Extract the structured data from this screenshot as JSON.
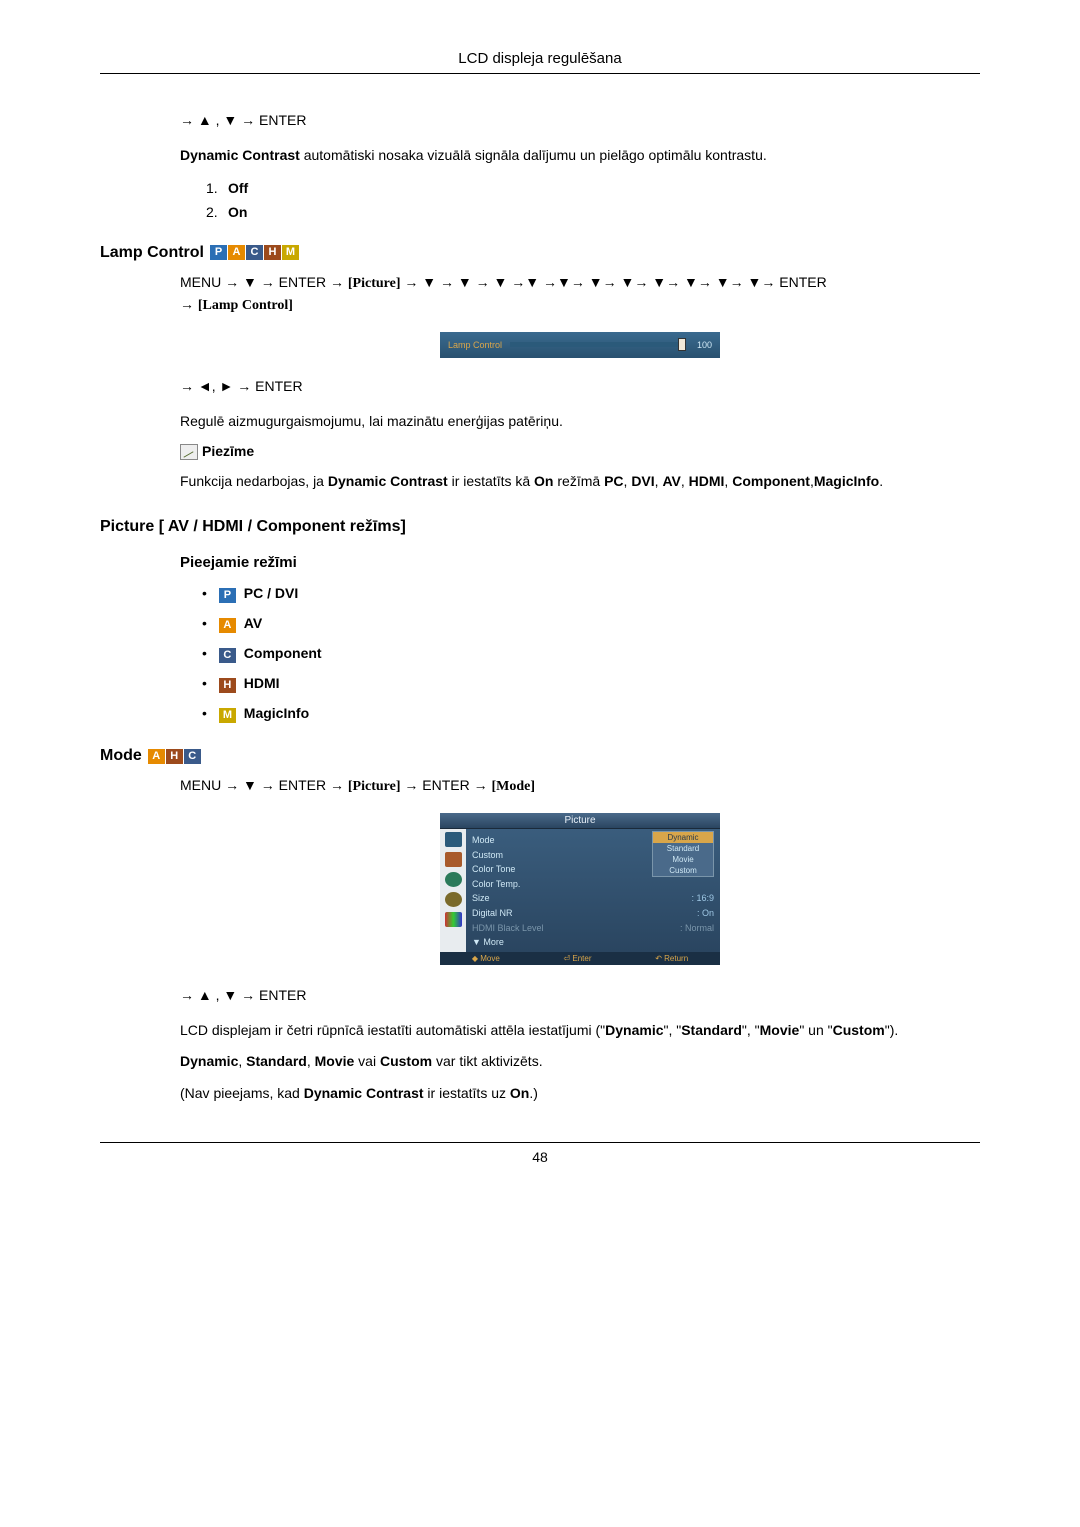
{
  "header": {
    "title": "LCD displeja regulēšana"
  },
  "dynamic_contrast": {
    "nav": "→ ▲ , ▼ → ENTER",
    "desc_prefix_bold": "Dynamic Contrast",
    "desc_rest": " automātiski nosaka vizuālā signāla dalījumu un pielāgo optimālu kontrastu.",
    "options": [
      "Off",
      "On"
    ]
  },
  "lamp_control": {
    "title": "Lamp Control",
    "badges": [
      "P",
      "A",
      "C",
      "H",
      "M"
    ],
    "nav_line1_pre": "MENU → ▼ → ENTER → ",
    "nav_line1_pic": "[Picture]",
    "nav_line1_post": " → ▼ → ▼ → ▼ →▼ →▼→ ▼→ ▼→ ▼→ ▼→ ▼→ ▼→ ENTER",
    "nav_line2": "→ ",
    "nav_line2_lc": "[Lamp Control]",
    "bar_label": "Lamp Control",
    "bar_value": "100",
    "nav_after": "→ ◄, ► → ENTER",
    "desc": "Regulē aizmugurgaismojumu, lai mazinātu enerģijas patēriņu.",
    "note_label": "Piezīme",
    "note_text_1": "Funkcija nedarbojas, ja ",
    "note_bold_1": "Dynamic Contrast",
    "note_text_2": " ir iestatīts kā ",
    "note_bold_2": "On",
    "note_text_3": " režīmā ",
    "note_bold_3": "PC",
    "note_bold_4": "DVI",
    "note_bold_5": "AV",
    "note_bold_6": "HDMI",
    "note_bold_7": "Component",
    "note_bold_8": "MagicInfo"
  },
  "picture_section": {
    "title": "Picture [ AV / HDMI / Component režīms]",
    "sub": "Pieejamie režīmi",
    "modes": [
      {
        "badge": "P",
        "label": "PC / DVI"
      },
      {
        "badge": "A",
        "label": "AV"
      },
      {
        "badge": "C",
        "label": "Component"
      },
      {
        "badge": "H",
        "label": "HDMI"
      },
      {
        "badge": "M",
        "label": "MagicInfo"
      }
    ]
  },
  "mode_section": {
    "title": "Mode",
    "badges": [
      "A",
      "H",
      "C"
    ],
    "nav_pre": "MENU → ▼ → ENTER → ",
    "nav_pic": "[Picture]",
    "nav_mid": " → ENTER → ",
    "nav_mode": "[Mode]",
    "osd": {
      "title": "Picture",
      "rows": [
        {
          "l": "Mode",
          "v": ": Dynamic"
        },
        {
          "l": "Custom",
          "v": ""
        },
        {
          "l": "Color Tone",
          "v": ""
        },
        {
          "l": "Color Temp.",
          "v": ""
        },
        {
          "l": "Size",
          "v": ": 16:9"
        },
        {
          "l": "Digital NR",
          "v": ": On"
        },
        {
          "l": "HDMI Black Level",
          "v": ": Normal",
          "dim": true
        },
        {
          "l": "▼ More",
          "v": ""
        }
      ],
      "dropdown": [
        "Dynamic",
        "Standard",
        "Movie",
        "Custom"
      ],
      "foot": [
        "◆ Move",
        "⏎ Enter",
        "↶ Return"
      ]
    },
    "nav_after": "→ ▲ , ▼ → ENTER",
    "para1_pre": "LCD displejam ir četri rūpnīcā iestatīti automātiski attēla iestatījumi (\"",
    "para1_b1": "Dynamic",
    "para1_m1": "\", \"",
    "para1_b2": "Standard",
    "para1_m2": "\", \"",
    "para1_b3": "Movie",
    "para1_m3": "\" un \"",
    "para1_b4": "Custom",
    "para1_post": "\").",
    "para2_b1": "Dynamic",
    "para2_b2": "Standard",
    "para2_b3": "Movie",
    "para2_m": " vai ",
    "para2_b4": "Custom",
    "para2_post": " var tikt aktivizēts.",
    "para3_pre": "(Nav pieejams, kad ",
    "para3_b1": "Dynamic Contrast",
    "para3_m": " ir iestatīts uz ",
    "para3_b2": "On",
    "para3_post": ".)"
  },
  "footer": {
    "page": "48"
  }
}
